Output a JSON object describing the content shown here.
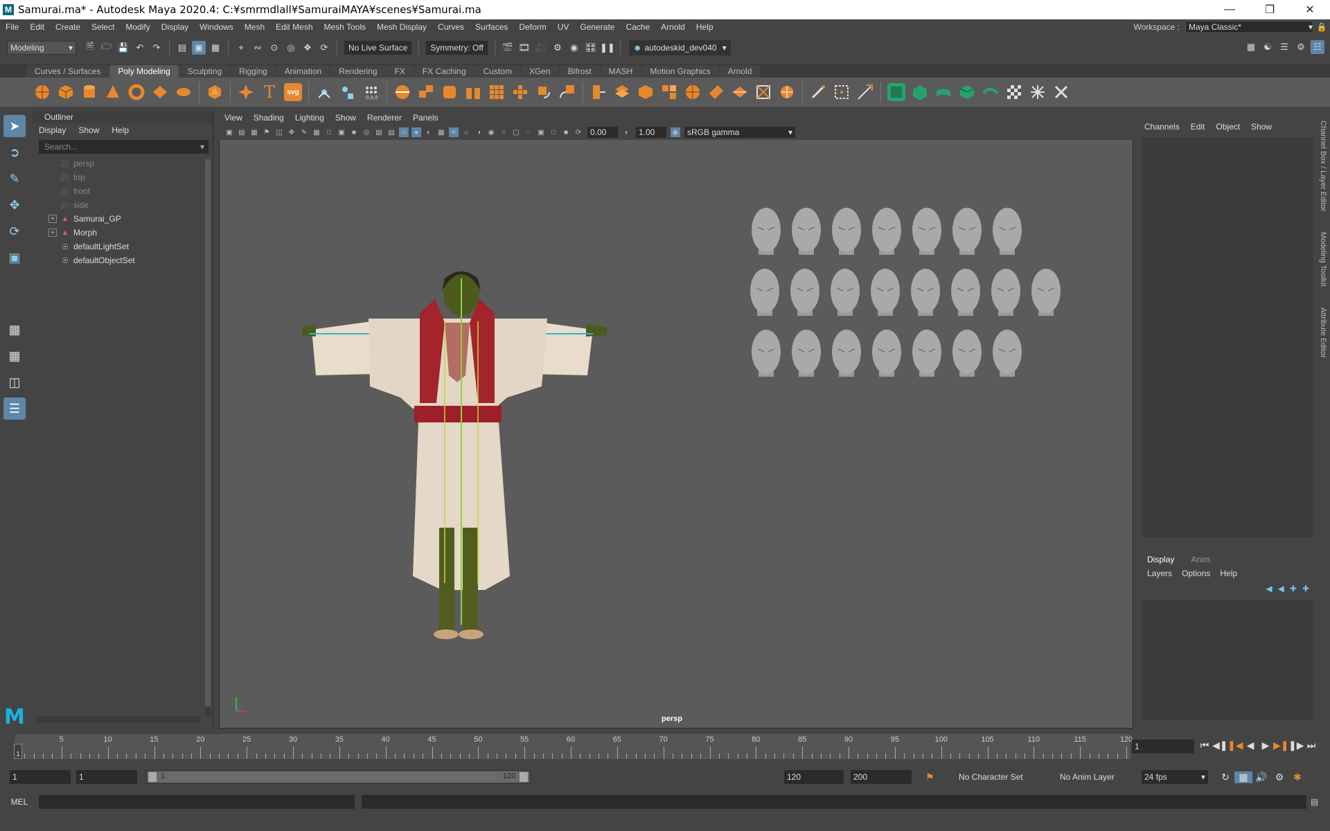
{
  "title_bar": {
    "title": "Samurai.ma* - Autodesk Maya 2020.4: C:¥smrmdlall¥SamuraiMAYA¥scenes¥Samurai.ma",
    "app_icon": "M",
    "buttons": [
      "minimize-icon",
      "restore-icon",
      "close-icon"
    ]
  },
  "menu_bar": {
    "items": [
      "File",
      "Edit",
      "Create",
      "Select",
      "Modify",
      "Display",
      "Windows",
      "Mesh",
      "Edit Mesh",
      "Mesh Tools",
      "Mesh Display",
      "Curves",
      "Surfaces",
      "Deform",
      "UV",
      "Generate",
      "Cache",
      "Arnold",
      "Help"
    ],
    "workspace_label": "Workspace :",
    "workspace_value": "Maya Classic*"
  },
  "status_line": {
    "menu_set": "Modeling",
    "live_surface": "No Live Surface",
    "symmetry": "Symmetry: Off",
    "user": "autodeskid_dev040"
  },
  "shelf": {
    "tabs": [
      "Curves / Surfaces",
      "Poly Modeling",
      "Sculpting",
      "Rigging",
      "Animation",
      "Rendering",
      "FX",
      "FX Caching",
      "Custom",
      "XGen",
      "Bifrost",
      "MASH",
      "Motion Graphics",
      "Arnold"
    ],
    "active_tab": "Poly Modeling",
    "svg_label": "svg",
    "text_label": "T"
  },
  "outliner": {
    "title": "Outliner",
    "menu": [
      "Display",
      "Show",
      "Help"
    ],
    "search_placeholder": "Search...",
    "items": [
      {
        "label": "persp",
        "type": "camera",
        "dim": true
      },
      {
        "label": "top",
        "type": "camera",
        "dim": true
      },
      {
        "label": "front",
        "type": "camera",
        "dim": true
      },
      {
        "label": "side",
        "type": "camera",
        "dim": true
      },
      {
        "label": "Samurai_GP",
        "type": "group",
        "expandable": true
      },
      {
        "label": "Morph",
        "type": "group",
        "expandable": true
      },
      {
        "label": "defaultLightSet",
        "type": "set"
      },
      {
        "label": "defaultObjectSet",
        "type": "set"
      }
    ]
  },
  "viewport": {
    "menu": [
      "View",
      "Shading",
      "Lighting",
      "Show",
      "Renderer",
      "Panels"
    ],
    "exposure": "0.00",
    "gamma": "1.00",
    "color_space": "sRGB gamma",
    "camera_label": "persp",
    "head_rows": [
      7,
      8,
      7
    ]
  },
  "channel_box": {
    "menu": [
      "Channels",
      "Edit",
      "Object",
      "Show"
    ],
    "side_tabs": [
      "Channel Box / Layer Editor",
      "Modeling Toolkit",
      "Attribute Editor"
    ]
  },
  "layer_editor": {
    "tabs": [
      "Display",
      "Anim"
    ],
    "active_tab": "Display",
    "menu": [
      "Layers",
      "Options",
      "Help"
    ]
  },
  "time_slider": {
    "ticks": [
      "5",
      "10",
      "15",
      "20",
      "25",
      "30",
      "35",
      "40",
      "45",
      "50",
      "55",
      "60",
      "65",
      "70",
      "75",
      "80",
      "85",
      "90",
      "95",
      "100",
      "105",
      "110",
      "115",
      "120"
    ],
    "current_marker": "1",
    "current_frame": "1"
  },
  "range_slider": {
    "start_frame": "1",
    "playback_start": "1",
    "range_start": "1",
    "range_end": "120",
    "playback_end": "120",
    "end_frame": "200",
    "character_set": "No Character Set",
    "anim_layer": "No Anim Layer",
    "fps": "24 fps"
  },
  "command_line": {
    "label": "MEL"
  },
  "colors": {
    "accent": "#5d86a8",
    "shelf_orange": "#e8882d",
    "shelf_green": "#26a36d",
    "maya_logo": "#19b3e0"
  }
}
